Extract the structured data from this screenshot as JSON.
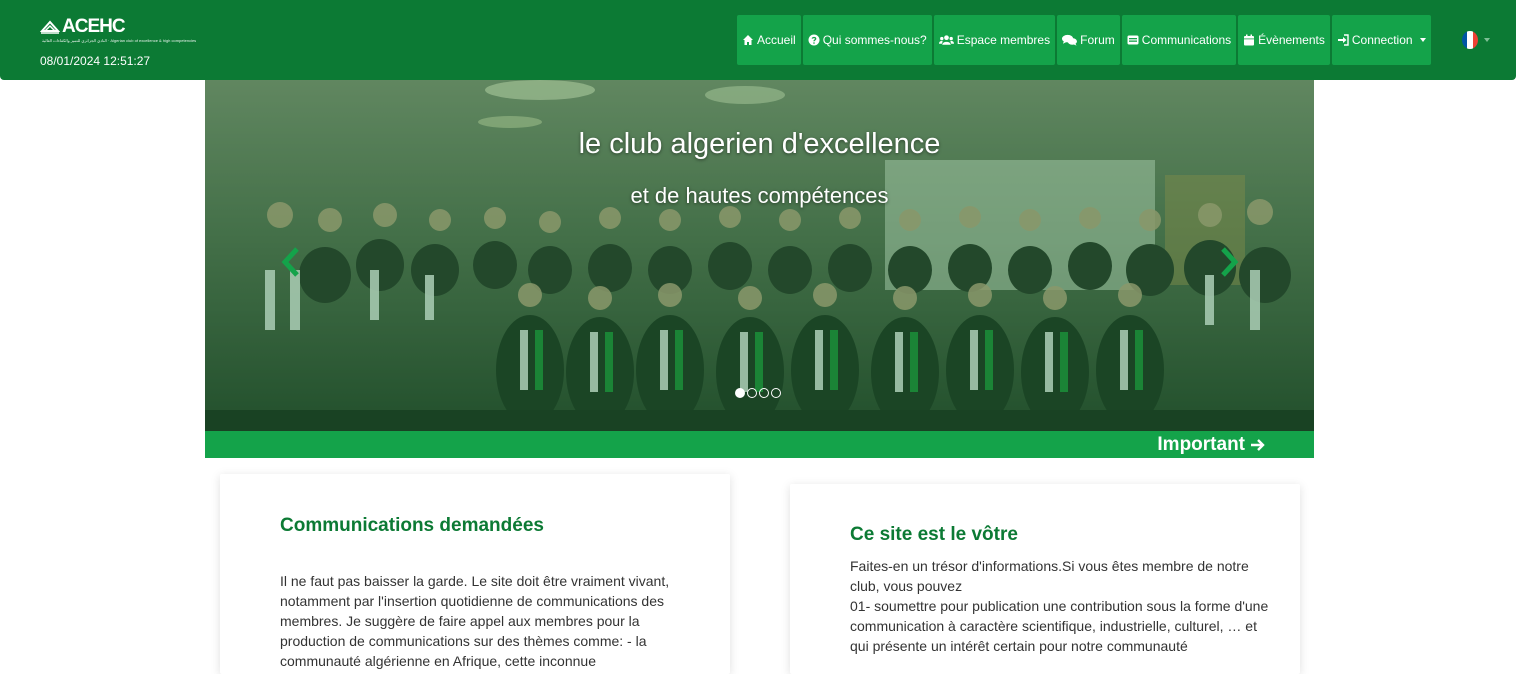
{
  "header": {
    "logo_text": "ACEHC",
    "logo_subtitle": "النادي الجزائري للتميز والكفاءات العالية · Algerian club of excellence & high competencies",
    "datetime": "08/01/2024 12:51:27"
  },
  "nav": {
    "items": [
      {
        "label": "Accueil",
        "icon": "home-icon"
      },
      {
        "label": "Qui sommes-nous?",
        "icon": "question-circle-icon"
      },
      {
        "label": "Espace membres",
        "icon": "users-icon"
      },
      {
        "label": "Forum",
        "icon": "comments-icon"
      },
      {
        "label": "Communications",
        "icon": "inbox-icon"
      },
      {
        "label": "Évènements",
        "icon": "calendar-icon"
      },
      {
        "label": "Connection",
        "icon": "sign-in-icon",
        "dropdown": true
      }
    ],
    "language": {
      "flag": "france-flag",
      "colors": [
        "#0055a4",
        "#ffffff",
        "#ef4135"
      ]
    }
  },
  "carousel": {
    "caption_title": "le club algerien d'excellence",
    "caption_subtitle": "et de hautes compétences",
    "slide_count": 4,
    "active_slide": 1,
    "arrow_color": "#14a34a"
  },
  "important": {
    "label": "Important"
  },
  "cards": {
    "communications": {
      "title": "Communications demandées",
      "body": "Il ne faut pas baisser la garde. Le site doit être vraiment vivant, notamment par l'insertion quotidienne de communications des membres. Je suggère de faire appel aux membres pour la production de communications sur des thèmes comme: - la communauté algérienne en Afrique, cette inconnue"
    },
    "site": {
      "title": "Ce site est le vôtre",
      "body": "Faites-en un trésor d'informations.Si vous êtes membre de notre club, vous pouvez\n01- soumettre pour publication une contribution sous la forme d'une communication à caractère scientifique, industrielle, culturel, … et qui présente un intérêt certain pour notre communauté"
    }
  },
  "colors": {
    "header_bg": "#0c7a34",
    "nav_item_bg": "#14a34a",
    "accent_green": "#0c7a34"
  }
}
